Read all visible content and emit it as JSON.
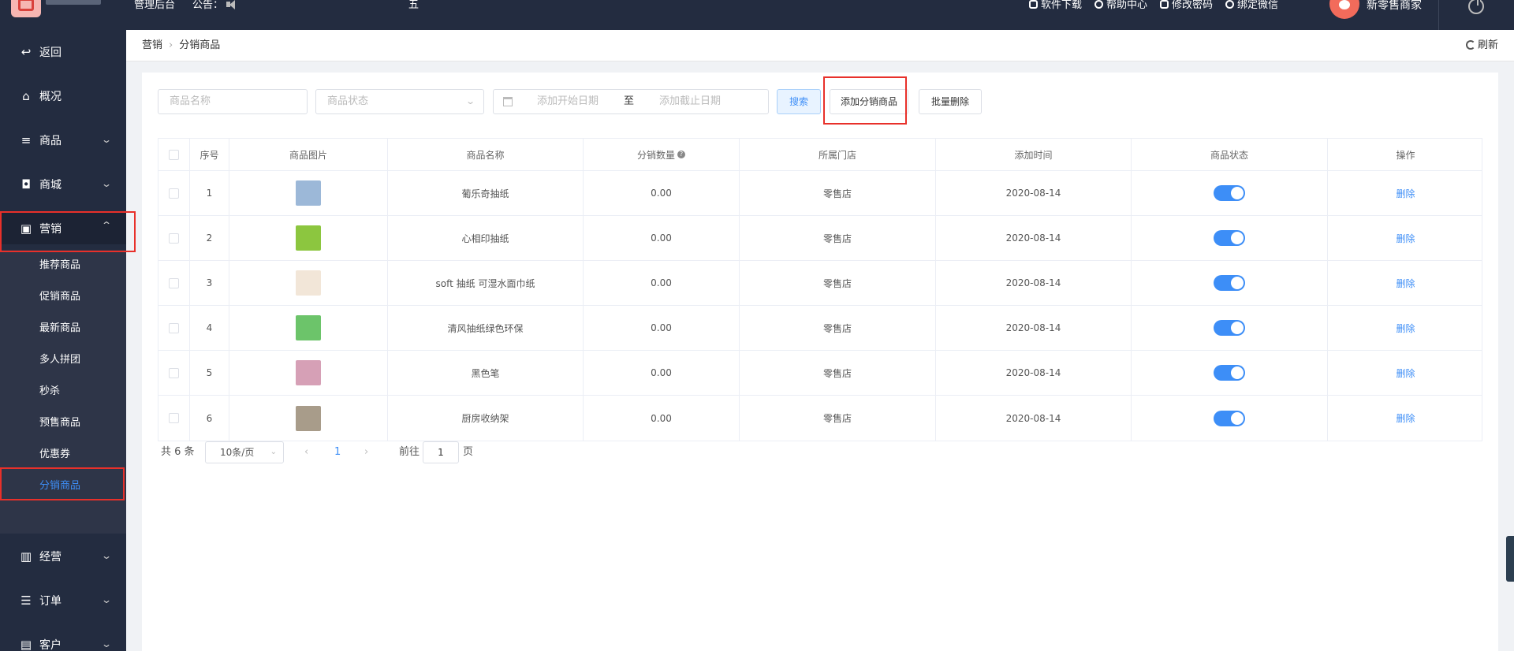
{
  "topbar": {
    "admin_title": "管理后台",
    "notice_label": "公告：",
    "marquee_char": "五",
    "links": [
      "软件下载",
      "帮助中心",
      "修改密码",
      "绑定微信"
    ],
    "merchant_name": "新零售商家"
  },
  "sidebar": {
    "back": "返回",
    "overview": "概况",
    "goods": "商品",
    "mall": "商城",
    "marketing": "营销",
    "sub_items": [
      "推荐商品",
      "促销商品",
      "最新商品",
      "多人拼团",
      "秒杀",
      "预售商品",
      "优惠券",
      "分销商品"
    ],
    "operation": "经营",
    "orders": "订单",
    "customers": "客户"
  },
  "breadcrumb": {
    "parent": "营销",
    "current": "分销商品",
    "refresh": "刷新"
  },
  "filters": {
    "name_placeholder": "商品名称",
    "status_placeholder": "商品状态",
    "start_placeholder": "添加开始日期",
    "range_separator": "至",
    "end_placeholder": "添加截止日期",
    "search_button": "搜索",
    "add_button": "添加分销商品",
    "batch_delete_button": "批量删除"
  },
  "table": {
    "headers": {
      "index": "序号",
      "image": "商品图片",
      "name": "商品名称",
      "quantity": "分销数量",
      "store": "所属门店",
      "added": "添加时间",
      "status": "商品状态",
      "action": "操作"
    },
    "action_label": "删除",
    "rows": [
      {
        "index": "1",
        "name": "葡乐奇抽纸",
        "quantity": "0.00",
        "store": "零售店",
        "added": "2020-08-14",
        "status_on": true,
        "thumb_color": "#9cb8d8"
      },
      {
        "index": "2",
        "name": "心相印抽纸",
        "quantity": "0.00",
        "store": "零售店",
        "added": "2020-08-14",
        "status_on": true,
        "thumb_color": "#8cc63f"
      },
      {
        "index": "3",
        "name": "soft 抽纸 可湿水面巾纸",
        "quantity": "0.00",
        "store": "零售店",
        "added": "2020-08-14",
        "status_on": true,
        "thumb_color": "#f2e6d8"
      },
      {
        "index": "4",
        "name": "清风抽纸绿色环保",
        "quantity": "0.00",
        "store": "零售店",
        "added": "2020-08-14",
        "status_on": true,
        "thumb_color": "#6cc46a"
      },
      {
        "index": "5",
        "name": "黑色笔",
        "quantity": "0.00",
        "store": "零售店",
        "added": "2020-08-14",
        "status_on": true,
        "thumb_color": "#d6a0b6"
      },
      {
        "index": "6",
        "name": "厨房收纳架",
        "quantity": "0.00",
        "store": "零售店",
        "added": "2020-08-14",
        "status_on": true,
        "thumb_color": "#a89c8a"
      }
    ]
  },
  "pagination": {
    "total": "共 6 条",
    "page_size": "10条/页",
    "current_page": "1",
    "goto_label": "前往",
    "goto_value": "1",
    "page_unit": "页"
  },
  "colors": {
    "sidebar_bg": "#232c40",
    "accent": "#3d8ef7",
    "highlight_box": "#e8302a"
  }
}
